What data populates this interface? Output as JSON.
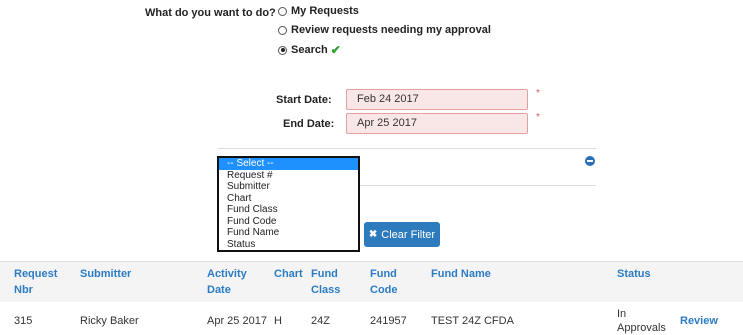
{
  "question": "What do you want to do?",
  "options": [
    {
      "label": "My Requests",
      "checked": false
    },
    {
      "label": "Review requests needing my approval",
      "checked": false
    },
    {
      "label": "Search",
      "checked": true
    }
  ],
  "search_check_icon": "checkmark-icon",
  "start_date": {
    "label": "Start Date:",
    "value": "Feb 24 2017",
    "required_mark": "*"
  },
  "end_date": {
    "label": "End Date:",
    "value": "Apr 25 2017",
    "required_mark": "*"
  },
  "filter_dropdown": {
    "options": [
      "-- Select --",
      "Request #",
      "Submitter",
      "Chart",
      "Fund Class",
      "Fund Code",
      "Fund Name",
      "Status"
    ],
    "selected": "-- Select --"
  },
  "clear_filter_label": "Clear Filter",
  "table": {
    "headers": {
      "request_nbr": [
        "Request",
        "Nbr"
      ],
      "submitter": "Submitter",
      "activity_date": [
        "Activity",
        "Date"
      ],
      "chart": "Chart",
      "fund_class": [
        "Fund",
        "Class"
      ],
      "fund_code": [
        "Fund",
        "Code"
      ],
      "fund_name": "Fund Name",
      "status": "Status"
    },
    "rows": [
      {
        "request_nbr": "315",
        "submitter": "Ricky Baker",
        "activity_date": "Apr 25 2017",
        "chart": "H",
        "fund_class": "24Z",
        "fund_code": "241957",
        "fund_name": "TEST 24Z CFDA",
        "status": [
          "In",
          "Approvals"
        ],
        "action": "Review"
      }
    ]
  },
  "colors": {
    "accent": "#2c7cc5",
    "button": "#2d7bbd",
    "error_bg": "#f9e6e6",
    "error_border": "#e3a0a0",
    "required": "#d9534f"
  }
}
